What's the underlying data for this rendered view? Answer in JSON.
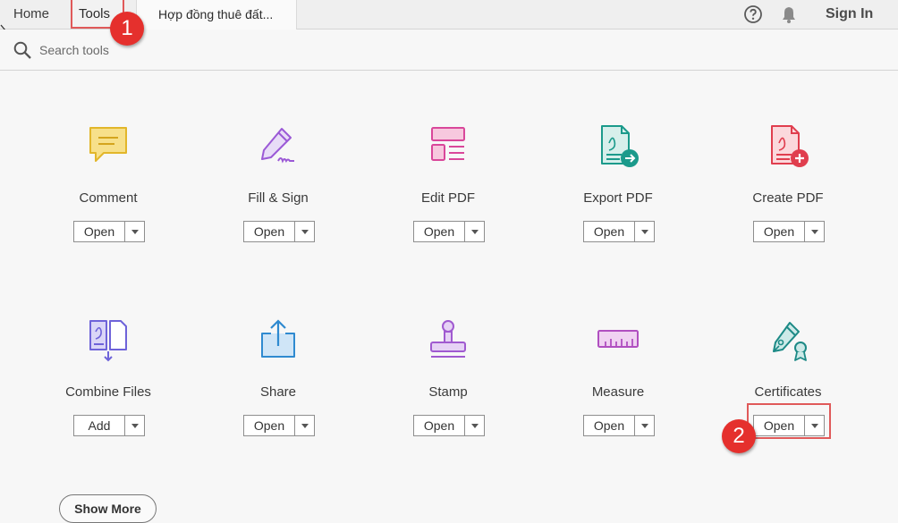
{
  "topbar": {
    "home_label": "Home",
    "tools_label": "Tools",
    "doc_tab_label": "Hợp đồng thuê đất...",
    "signin_label": "Sign In",
    "icons": [
      "help-icon",
      "bell-icon"
    ]
  },
  "search": {
    "placeholder": "Search tools"
  },
  "tools": [
    {
      "name": "Comment",
      "button": "Open",
      "icon": "comment-icon",
      "color": "#e2b62a"
    },
    {
      "name": "Fill & Sign",
      "button": "Open",
      "icon": "fill-sign-icon",
      "color": "#9b59d6"
    },
    {
      "name": "Edit PDF",
      "button": "Open",
      "icon": "edit-pdf-icon",
      "color": "#d9479a"
    },
    {
      "name": "Export PDF",
      "button": "Open",
      "icon": "export-pdf-icon",
      "color": "#1b9a8b"
    },
    {
      "name": "Create PDF",
      "button": "Open",
      "icon": "create-pdf-icon",
      "color": "#e03e4e"
    },
    {
      "name": "Combine Files",
      "button": "Add",
      "icon": "combine-files-icon",
      "color": "#6e63d9"
    },
    {
      "name": "Share",
      "button": "Open",
      "icon": "share-icon",
      "color": "#2f8ad0"
    },
    {
      "name": "Stamp",
      "button": "Open",
      "icon": "stamp-icon",
      "color": "#a05ad0"
    },
    {
      "name": "Measure",
      "button": "Open",
      "icon": "measure-icon",
      "color": "#b04fc0"
    },
    {
      "name": "Certificates",
      "button": "Open",
      "icon": "certificates-icon",
      "color": "#1d8a86"
    }
  ],
  "annotations": {
    "badge1": "1",
    "badge2": "2",
    "highlight_color": "#e05a5a",
    "badge_color": "#e5302d"
  },
  "show_more_label": "Show More"
}
